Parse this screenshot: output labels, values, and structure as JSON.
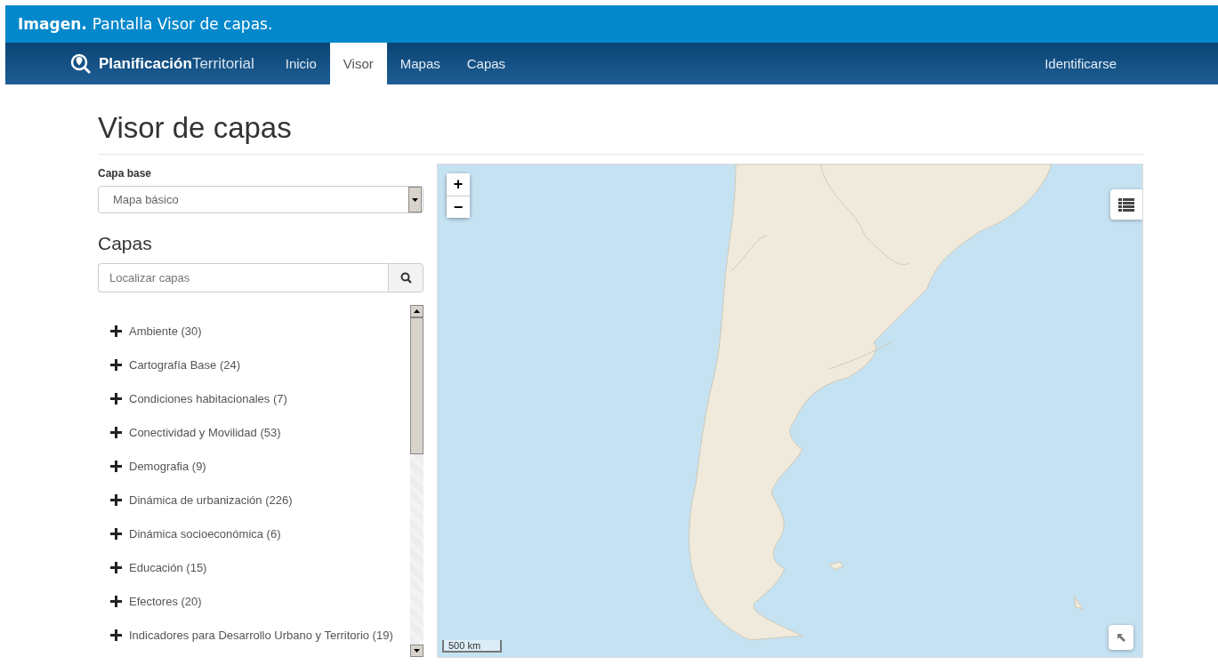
{
  "caption": {
    "label": "Imagen.",
    "text": "Pantalla Visor de capas."
  },
  "navbar": {
    "brand_bold": "Planificación",
    "brand_light": "Territorial",
    "tabs": [
      {
        "label": "Inicio",
        "selected": false
      },
      {
        "label": "Visor",
        "selected": true
      },
      {
        "label": "Mapas",
        "selected": false
      },
      {
        "label": "Capas",
        "selected": false
      }
    ],
    "login": "Identificarse"
  },
  "page_title": "Visor de capas",
  "base_layer": {
    "label": "Capa base",
    "value": "Mapa básico"
  },
  "layers": {
    "heading": "Capas",
    "search_placeholder": "Localizar capas",
    "items": [
      {
        "label": "Ambiente (30)",
        "expanded": false
      },
      {
        "label": "Cartografía Base (24)",
        "expanded": false
      },
      {
        "label": "Condiciones habitacionales (7)",
        "expanded": false
      },
      {
        "label": "Conectividad y Movilidad (53)",
        "expanded": false
      },
      {
        "label": "Demografia (9)",
        "expanded": false
      },
      {
        "label": "Dinámica de urbanización (226)",
        "expanded": false
      },
      {
        "label": "Dinámica socioeconómica (6)",
        "expanded": false
      },
      {
        "label": "Educación (15)",
        "expanded": false
      },
      {
        "label": "Efectores (20)",
        "expanded": false
      },
      {
        "label": "Indicadores para Desarrollo Urbano y Territorio (19)",
        "expanded": false
      }
    ]
  },
  "map": {
    "zoom_in": "+",
    "zoom_out": "−",
    "scale": "500 km"
  }
}
